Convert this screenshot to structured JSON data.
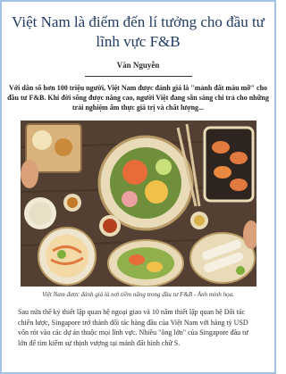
{
  "article": {
    "title": "Việt Nam là điểm đến lí tưởng cho đầu tư lĩnh vực F&B",
    "author": "Văn Nguyễn",
    "lead": "Với dân số hơn 100 triệu người, Việt Nam được đánh giá là \"mảnh đất màu mỡ\" cho đầu tư F&B. Khi đời sống được nâng cao, người Việt đang sẵn sàng chi trả cho những trải nghiệm ẩm thực giá trị và chất lượng...",
    "image_caption": "Việt Nam được đánh giá là nơi tiềm năng trong đầu tư F&B - Ảnh minh họa.",
    "body": "Sau nửa thế kỷ thiết lập quan hệ ngoại giao và 10 năm thiết lập quan hệ Đối tác chiến lược, Singapore trở thành đối tác hàng đầu của Việt Nam với hàng tỷ USD vốn rót vào các dự án thuộc mọi lĩnh vực. Nhiều \"ông lớn\" của Singapore đầu tư lớn để tìm kiếm sự thịnh vượng tại mảnh đất hình chữ S."
  },
  "colors": {
    "frame_border": "#9fc4e8",
    "title_text": "#1f3b63",
    "table_wood": "#4a3a2e"
  }
}
